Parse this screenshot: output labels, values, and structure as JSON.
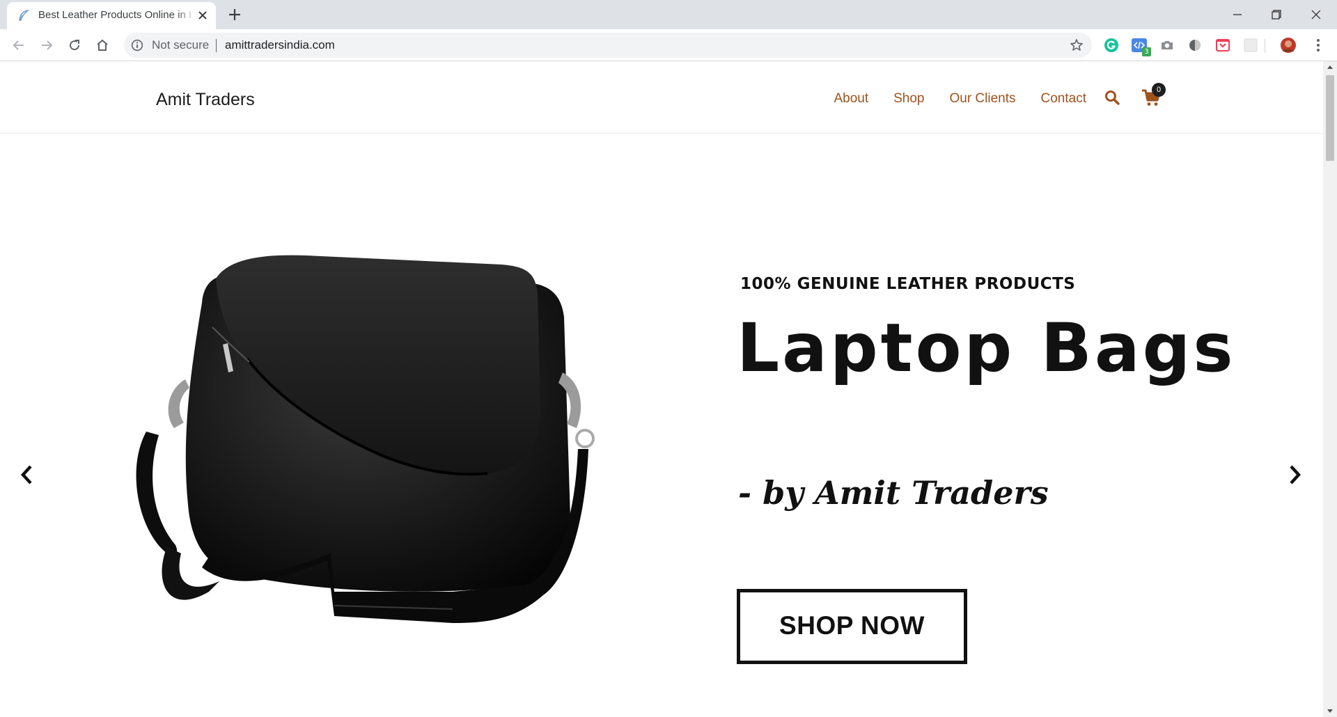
{
  "browser": {
    "tab_title": "Best Leather Products Online in I",
    "security_label": "Not secure",
    "url": "amittradersindia.com",
    "extensions": [
      {
        "name": "grammarly-icon",
        "color": "#15c39a"
      },
      {
        "name": "code-extension-icon",
        "badge": "3",
        "color": "#4a86e8"
      },
      {
        "name": "camera-icon"
      },
      {
        "name": "circle-extension-icon"
      },
      {
        "name": "pocket-icon",
        "color": "#ef3f56"
      },
      {
        "name": "blank-extension-icon"
      },
      {
        "name": "profile-avatar"
      }
    ]
  },
  "site": {
    "brand": "Amit Traders",
    "menu": [
      {
        "label": "About"
      },
      {
        "label": "Shop"
      },
      {
        "label": "Our Clients"
      },
      {
        "label": "Contact"
      }
    ],
    "cart_count": "0",
    "accent_color": "#a0521d"
  },
  "hero": {
    "eyebrow": "100% GENUINE LEATHER PRODUCTS",
    "headline": "Laptop Bags",
    "byline": "- by Amit Traders",
    "cta": "SHOP NOW"
  }
}
